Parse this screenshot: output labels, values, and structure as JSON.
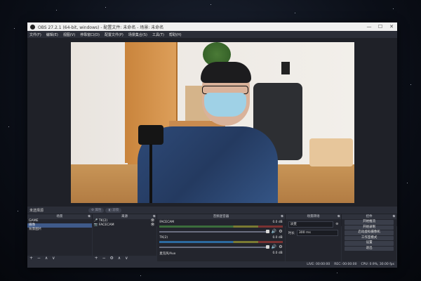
{
  "window": {
    "title": "OBS 27.2.1 (64-bit, windows) - 配置文件: 未命名 - 场景: 未命名",
    "controls": [
      "—",
      "☐",
      "✕"
    ]
  },
  "menu": [
    "文件(F)",
    "编辑(E)",
    "视图(V)",
    "停靠窗口(D)",
    "配置文件(P)",
    "场景集合(S)",
    "工具(T)",
    "帮助(H)"
  ],
  "source_header": {
    "label": "未选择源",
    "properties": "属性",
    "filters": "滤镜"
  },
  "scenes": {
    "title": "场景",
    "items": [
      "GAME",
      "摄像",
      "背景图片"
    ],
    "selected_index": 1,
    "footer": "+ − ∧ ∨"
  },
  "sources": {
    "title": "来源",
    "items": [
      "TK(2)",
      "FACECAM"
    ],
    "footer": "+ − ⚙ ∧ ∨"
  },
  "mixer": {
    "title": "音频混音器",
    "channels": [
      {
        "name": "FACECAM",
        "db": "0.0 dB"
      },
      {
        "name": "TK(2)",
        "db": "0.0 dB"
      },
      {
        "name": "麦克风/Aux",
        "db": "0.0 dB"
      }
    ]
  },
  "transitions": {
    "title": "场景转场",
    "type": "淡变",
    "duration_label": "时长",
    "duration": "300 ms"
  },
  "controls": {
    "title": "控件",
    "buttons": [
      "开始推流",
      "开始录制",
      "启动虚拟摄像机",
      "工作室模式",
      "设置",
      "退出"
    ]
  },
  "status": {
    "live": "LIVE: 00:00:00",
    "rec": "REC: 00:00:00",
    "cpu": "CPU: 0.9%, 30.00 fps"
  },
  "colors": {
    "accent": "#3f5a8a",
    "panel": "#23252d",
    "window": "#2b2e38"
  }
}
